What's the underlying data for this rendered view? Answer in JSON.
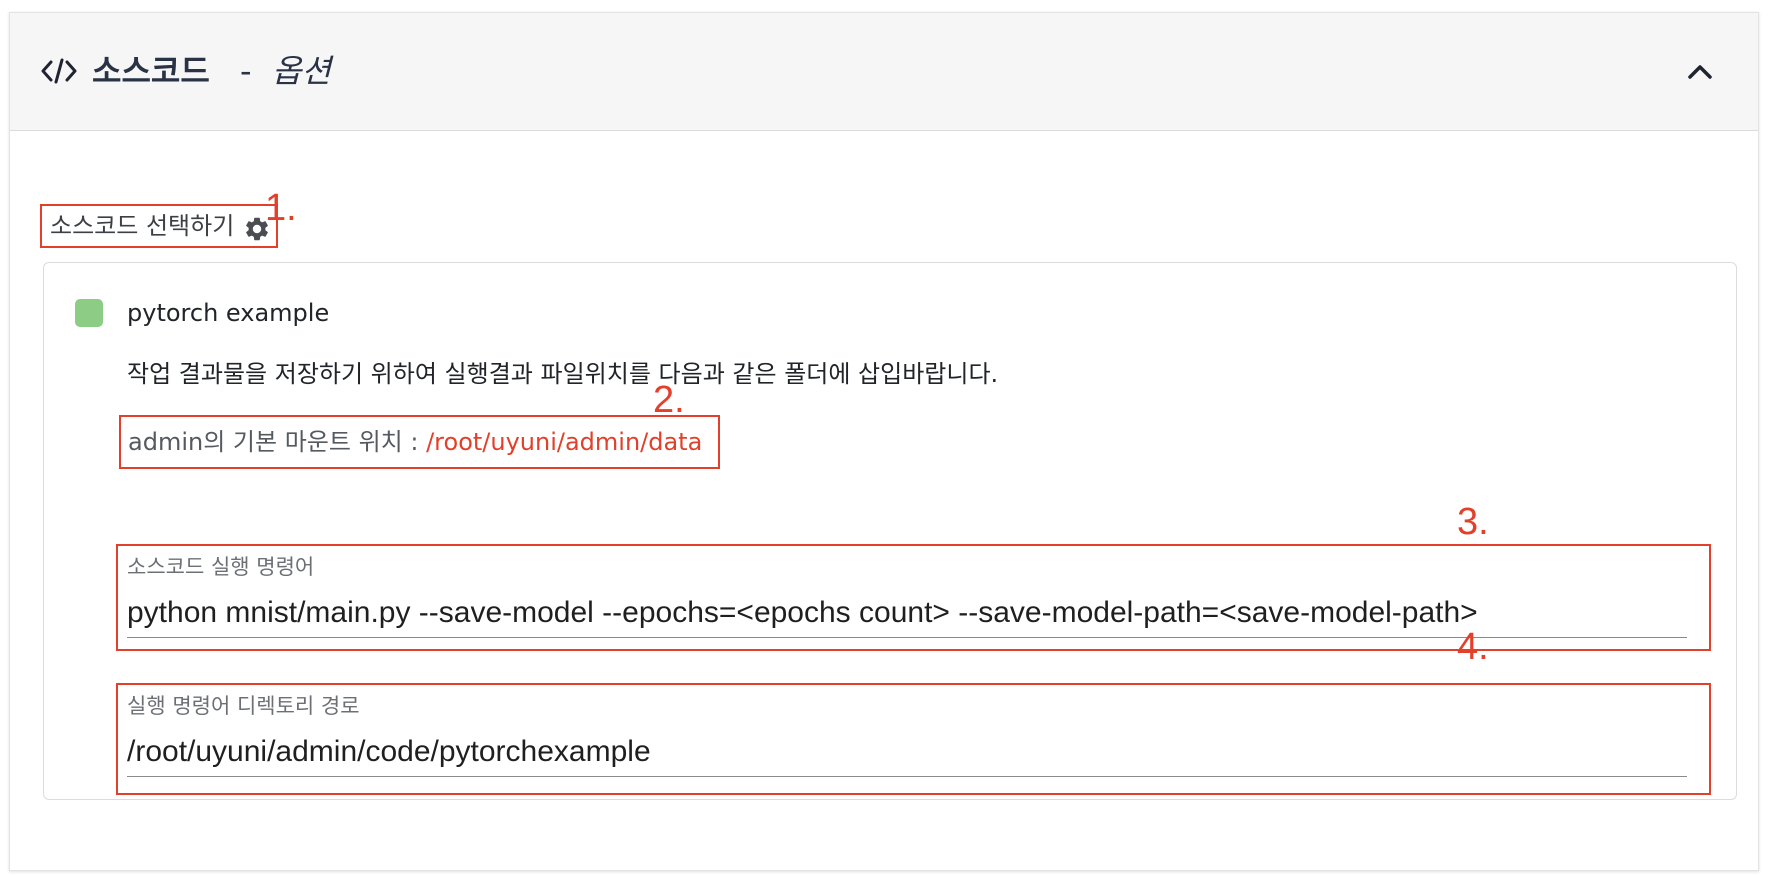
{
  "header": {
    "title": "소스코드",
    "separator": "-",
    "optional": "옵션"
  },
  "source_select": {
    "label": "소스코드 선택하기"
  },
  "annotations": [
    "1.",
    "2.",
    "3.",
    "4."
  ],
  "source": {
    "name": "pytorch example",
    "status_color": "#8ccc85",
    "description": "작업 결과물을 저장하기 위하여 실행결과 파일위치를 다음과 같은 폴더에 삽입바랍니다.",
    "mount_label": "admin의 기본 마운트 위치 : ",
    "mount_path": "/root/uyuni/admin/data"
  },
  "fields": {
    "command": {
      "label": "소스코드 실행 명령어",
      "value": "python mnist/main.py --save-model --epochs=<epochs count> --save-model-path=<save-model-path>"
    },
    "directory": {
      "label": "실행 명령어 디렉토리 경로",
      "value": "/root/uyuni/admin/code/pytorchexample"
    }
  },
  "colors": {
    "annotation": "#e2402a",
    "header_bg": "#f6f6f6"
  }
}
